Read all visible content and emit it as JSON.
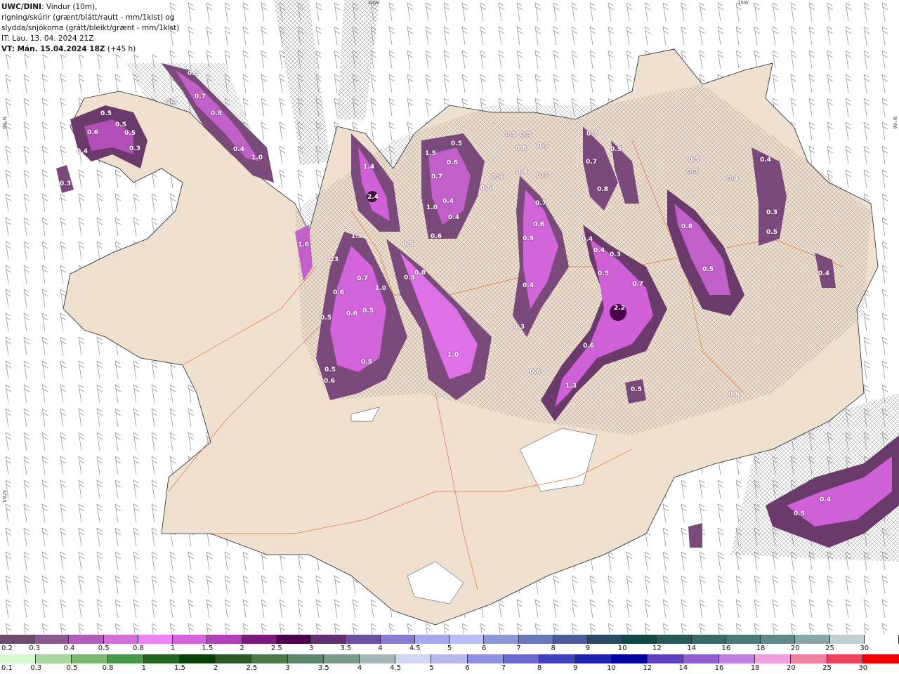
{
  "header": {
    "model": "UWC/DINI",
    "line1_rest": ": Vindur (10m),",
    "line2": "rigning/skúrir (grænt/blátt/rautt - mm/1klst) og",
    "line3": "slydda/snjókoma (grátt/bleikt/grænt - mm/1klst)",
    "line4": "IT: Lau. 13. 04. 2024 21Z",
    "line5_bold": "VT: Mán. 15.04.2024 18Z",
    "line5_rest": " (+45 h)"
  },
  "coords": {
    "top_20w": "20W",
    "top_15w": "15W",
    "left_66n": "N°66",
    "right_66n": "N°66",
    "left_65n": "N°65"
  },
  "values": [
    "0.5",
    "0.7",
    "0.8",
    "0.5",
    "0.5",
    "0.6",
    "0.5",
    "0.4",
    "0.3",
    "0.5",
    "0.4",
    "1.0",
    "0.3",
    "1.4",
    "2.4",
    "1.6",
    "1.9",
    "1.3",
    "0.6",
    "0.5",
    "0.6",
    "0.5",
    "0.5",
    "0.6",
    "0.7",
    "1.0",
    "0.5",
    "0.5",
    "0.9",
    "0.8",
    "1.0",
    "1.5",
    "0.5",
    "0.6",
    "0.7",
    "0.4",
    "0.4",
    "0.6",
    "1.0",
    "0.5",
    "0.4",
    "0.5",
    "0.5",
    "0.6",
    "0.5",
    "0.3",
    "0.4",
    "0.7",
    "0.6",
    "0.9",
    "0.4",
    "0.3",
    "0.6",
    "0.7",
    "0.7",
    "0.8",
    "0.4",
    "0.4",
    "0.3",
    "0.5",
    "0.7",
    "2.2",
    "0.6",
    "1.3",
    "0.5",
    "0.5",
    "0.3",
    "0.5",
    "0.4",
    "0.4",
    "0.3",
    "0.5",
    "0.8",
    "0.5",
    "0.4",
    "0.6",
    "0.5",
    "0.4"
  ],
  "legend_top": {
    "labels": [
      "0.2",
      "0.3",
      "0.4",
      "0.5",
      "0.8",
      "1",
      "1.5",
      "2",
      "2.5",
      "3",
      "3.5",
      "4",
      "4.5",
      "5",
      "6",
      "7",
      "8",
      "9",
      "10",
      "12",
      "14",
      "16",
      "18",
      "20",
      "25",
      "30"
    ],
    "colors": [
      "#6e4a6e",
      "#8a5a8e",
      "#b060b8",
      "#d070d8",
      "#ec84f4",
      "#d464dc",
      "#b040b8",
      "#7a1a7a",
      "#4a004a",
      "#603070",
      "#6e50a0",
      "#8a7ad0",
      "#a8a8f0",
      "#b8c0f4",
      "#8a98d8",
      "#6878b8",
      "#4a5c98",
      "#2a4a68",
      "#104848",
      "#285858",
      "#386868",
      "#4a7878",
      "#608888",
      "#88a8a8",
      "#c0d0d0",
      "#ffffff"
    ]
  },
  "legend_bottom": {
    "labels": [
      "0.1",
      "0.3",
      "0.5",
      "0.8",
      "1",
      "1.5",
      "2",
      "2.5",
      "3",
      "3.5",
      "4",
      "4.5",
      "5",
      "6",
      "7",
      "8",
      "9",
      "10",
      "12",
      "14",
      "16",
      "18",
      "20",
      "25",
      "30"
    ],
    "colors": [
      "#d8f8d0",
      "#a8d8a0",
      "#78b870",
      "#48984a",
      "#206820",
      "#084008",
      "#2a5a2a",
      "#4a7a4a",
      "#5a8a6a",
      "#7a9a8a",
      "#a8b8b8",
      "#d0d8f0",
      "#b8b8f0",
      "#9090e0",
      "#6868d0",
      "#4040c0",
      "#2020b0",
      "#0000a0",
      "#6040c0",
      "#9060d0",
      "#c080e0",
      "#f0a0e0",
      "#f080a0",
      "#f04060",
      "#f00000"
    ]
  }
}
